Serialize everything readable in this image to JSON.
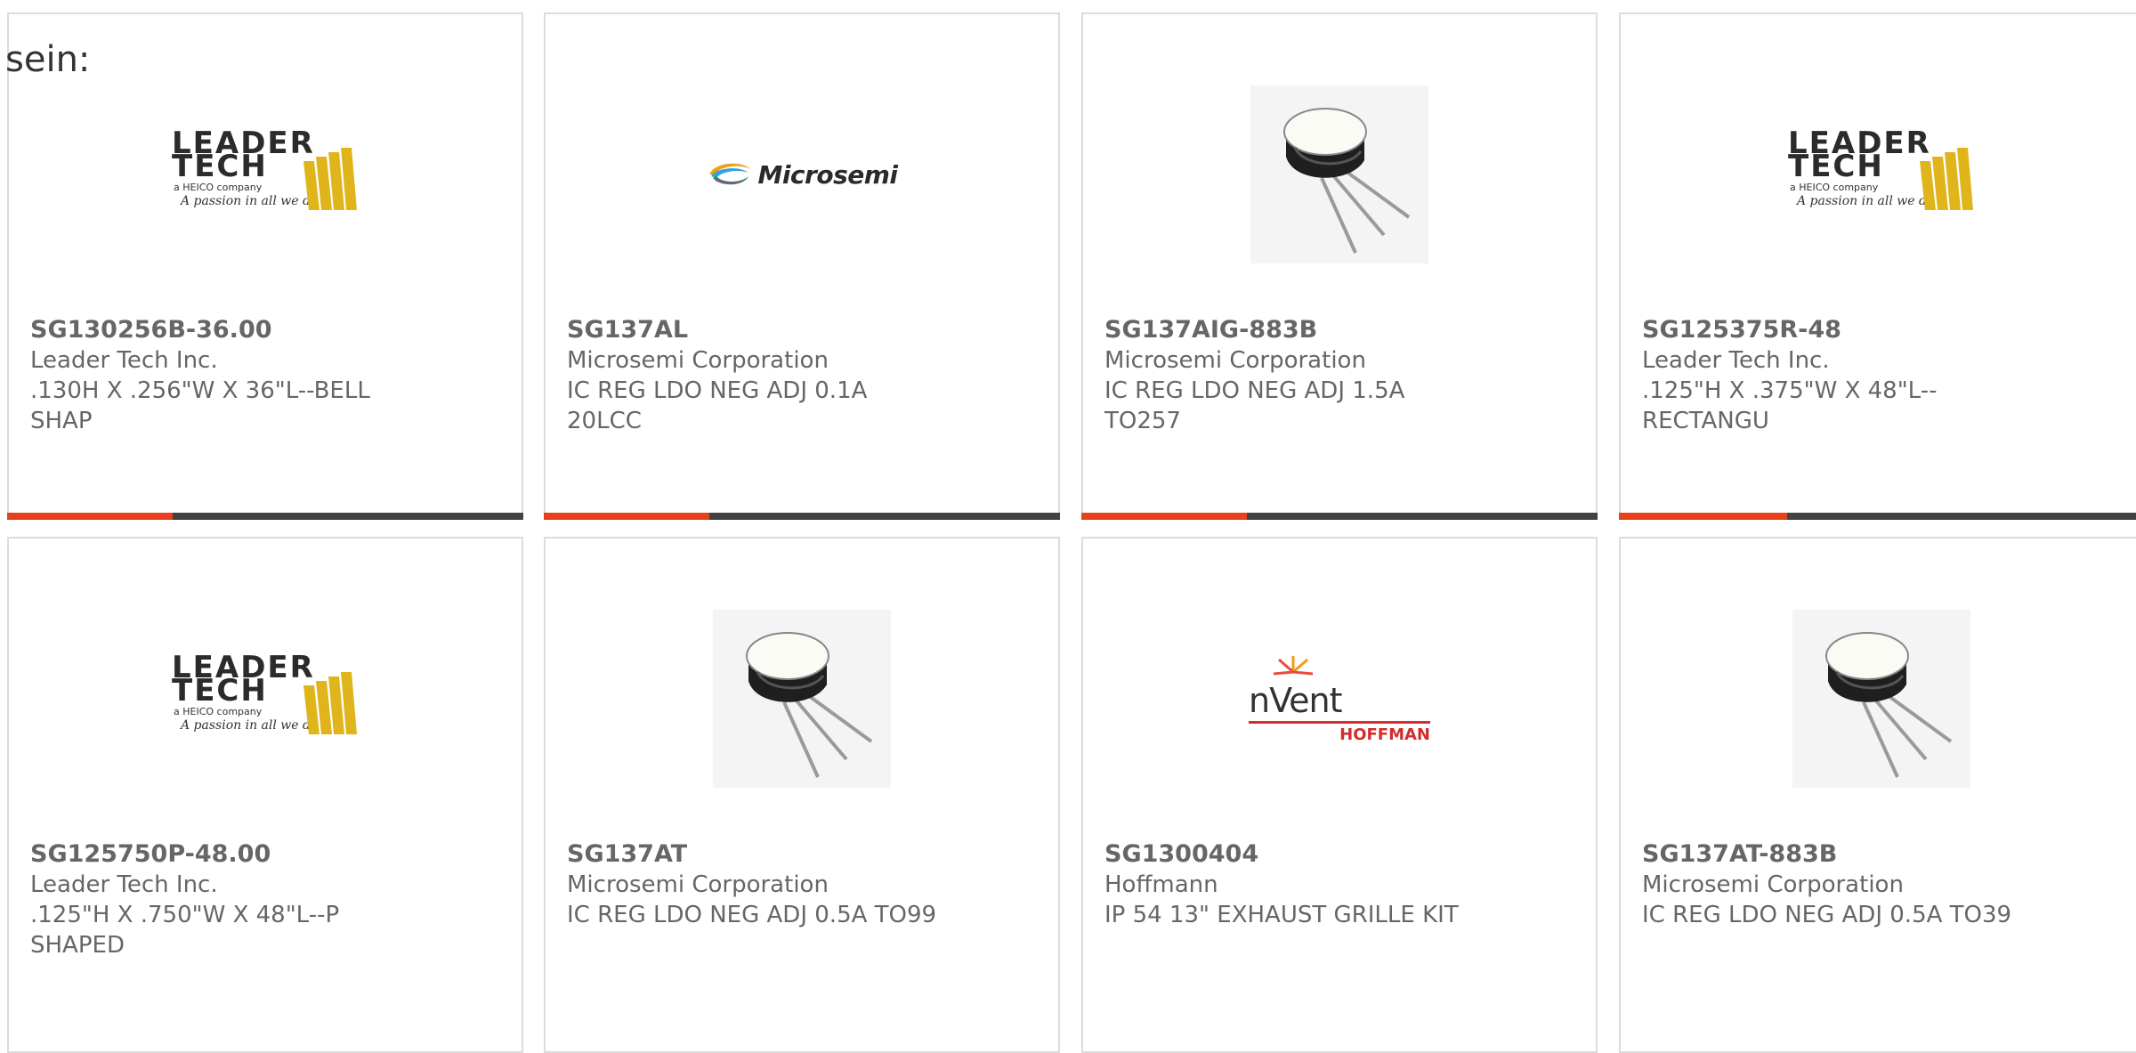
{
  "intro_text": "sein:",
  "colors": {
    "accent": "#e8401c",
    "progress_track": "#424242",
    "text": "#666666",
    "border": "#dcdcdc"
  },
  "products": [
    {
      "part_number": "SG130256B-36.00",
      "manufacturer": "Leader Tech Inc.",
      "description": ".130H X .256\"W X 36\"L--BELL SHAP",
      "image": "leader-tech-logo",
      "logo_text": {
        "line1": "LEADER",
        "line2": "TECH",
        "sub": "a HEICO company",
        "tag": "A passion in all we do"
      },
      "progress": 0.32
    },
    {
      "part_number": "SG137AL",
      "manufacturer": "Microsemi Corporation",
      "description": "IC REG LDO NEG ADJ 0.1A 20LCC",
      "image": "microsemi-logo",
      "logo_text": {
        "name": "Microsemi"
      },
      "progress": 0.32
    },
    {
      "part_number": "SG137AIG-883B",
      "manufacturer": "Microsemi Corporation",
      "description": "IC REG LDO NEG ADJ 1.5A TO257",
      "image": "transistor-photo",
      "progress": 0.32
    },
    {
      "part_number": "SG125375R-48",
      "manufacturer": "Leader Tech Inc.",
      "description": ".125\"H X .375\"W X 48\"L--RECTANGU",
      "image": "leader-tech-logo",
      "logo_text": {
        "line1": "LEADER",
        "line2": "TECH",
        "sub": "a HEICO company",
        "tag": "A passion in all we do"
      },
      "progress": 0.32
    },
    {
      "part_number": "SG125750P-48.00",
      "manufacturer": "Leader Tech Inc.",
      "description": ".125\"H X .750\"W X 48\"L--P SHAPED",
      "image": "leader-tech-logo",
      "logo_text": {
        "line1": "LEADER",
        "line2": "TECH",
        "sub": "a HEICO company",
        "tag": "A passion in all we do"
      }
    },
    {
      "part_number": "SG137AT",
      "manufacturer": "Microsemi Corporation",
      "description": "IC REG LDO NEG ADJ 0.5A TO99",
      "image": "transistor-photo"
    },
    {
      "part_number": "SG1300404",
      "manufacturer": "Hoffmann",
      "description": "IP 54 13\" EXHAUST GRILLE KIT",
      "image": "nvent-hoffman-logo",
      "logo_text": {
        "brand": "nVent",
        "sub": "HOFFMAN"
      }
    },
    {
      "part_number": "SG137AT-883B",
      "manufacturer": "Microsemi Corporation",
      "description": "IC REG LDO NEG ADJ 0.5A TO39",
      "image": "transistor-photo"
    }
  ]
}
